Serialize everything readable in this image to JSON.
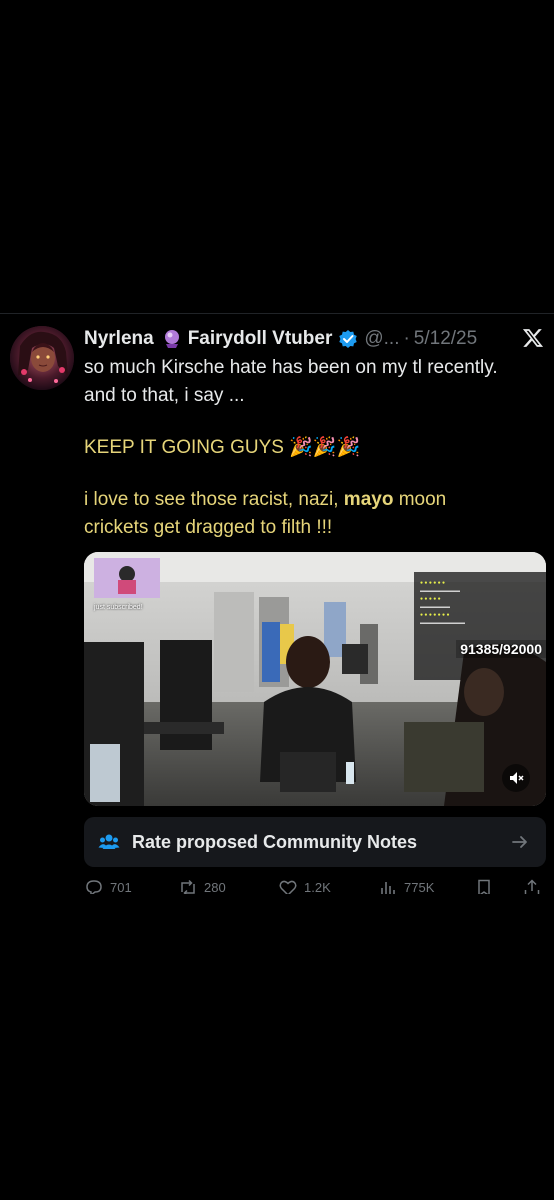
{
  "tweet": {
    "display_name": "Nyrlena",
    "name_suffix": "Fairydoll Vtuber",
    "handle": "@...",
    "separator": "·",
    "date": "5/12/25",
    "lines": [
      "so much Kirsche hate has been on my tl recently.",
      "and to that, i say ..."
    ],
    "keep_going": "KEEP IT GOING GUYS",
    "party_emojis": "🎉🎉🎉",
    "line3_part1": "i love to see those racist, nazi, ",
    "line3_bold": "mayo",
    "line3_part2": " moon",
    "line4": "crickets get dragged to filth !!!"
  },
  "media": {
    "counter": "91385/92000",
    "subscriber_text": "just subscribed!"
  },
  "community_notes": {
    "label": "Rate proposed Community Notes"
  },
  "actions": {
    "replies": "701",
    "reposts": "280",
    "likes": "1.2K",
    "views": "775K"
  },
  "colors": {
    "background": "#000000",
    "text": "#e7e9ea",
    "muted": "#71767b",
    "verified_blue": "#1d9bf0",
    "notes_bg": "#16181c",
    "yellow_tint": "#e6d57a"
  }
}
